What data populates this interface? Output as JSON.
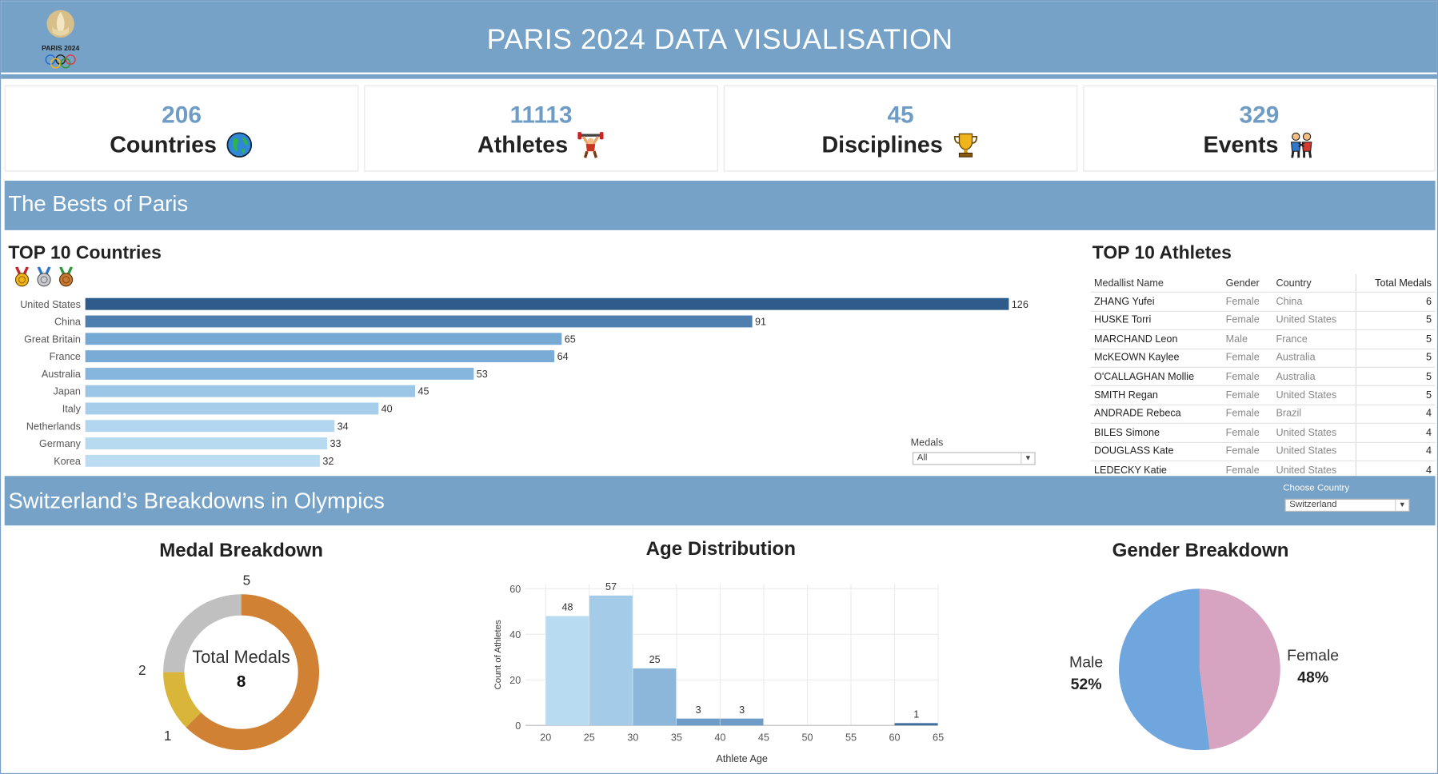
{
  "header": {
    "title": "PARIS 2024 DATA VISUALISATION",
    "logo_text": "PARIS 2024"
  },
  "kpis": [
    {
      "value": "206",
      "label": "Countries",
      "icon": "globe-icon"
    },
    {
      "value": "11113",
      "label": "Athletes",
      "icon": "weightlifter-icon"
    },
    {
      "value": "45",
      "label": "Disciplines",
      "icon": "trophy-icon"
    },
    {
      "value": "329",
      "label": "Events",
      "icon": "wrestlers-icon"
    }
  ],
  "bests_band": "The Bests of Paris",
  "country_band": "Switzerland’s Breakdowns in Olympics",
  "country_filter": {
    "label": "Choose Country",
    "value": "Switzerland"
  },
  "medal_filter": {
    "label": "Medals",
    "value": "All"
  },
  "top_athletes": {
    "title": "TOP 10 Athletes",
    "columns": [
      "Medallist Name",
      "Gender",
      "Country",
      "Total Medals"
    ],
    "rows": [
      [
        "ZHANG Yufei",
        "Female",
        "China",
        "6"
      ],
      [
        "HUSKE Torri",
        "Female",
        "United States",
        "5"
      ],
      [
        "MARCHAND Leon",
        "Male",
        "France",
        "5"
      ],
      [
        "McKEOWN Kaylee",
        "Female",
        "Australia",
        "5"
      ],
      [
        "O'CALLAGHAN Mollie",
        "Female",
        "Australia",
        "5"
      ],
      [
        "SMITH Regan",
        "Female",
        "United States",
        "5"
      ],
      [
        "ANDRADE Rebeca",
        "Female",
        "Brazil",
        "4"
      ],
      [
        "BILES Simone",
        "Female",
        "United States",
        "4"
      ],
      [
        "DOUGLASS Kate",
        "Female",
        "United States",
        "4"
      ],
      [
        "LEDECKY Katie",
        "Female",
        "United States",
        "4"
      ]
    ]
  },
  "chart_data": [
    {
      "type": "bar",
      "title": "TOP 10 Countries",
      "orientation": "horizontal",
      "categories": [
        "United States",
        "China",
        "Great Britain",
        "France",
        "Australia",
        "Japan",
        "Italy",
        "Netherlands",
        "Germany",
        "Korea"
      ],
      "values": [
        126,
        91,
        65,
        64,
        53,
        45,
        40,
        34,
        33,
        32
      ],
      "colors": [
        "#2e5b8a",
        "#4f7fae",
        "#76a8d4",
        "#7aabd6",
        "#86b5dd",
        "#9cc6e6",
        "#a6cdea",
        "#b2d6ef",
        "#b8daf1",
        "#bcdcf2"
      ],
      "xlim": [
        0,
        126
      ],
      "legend_icons": [
        "gold-medal-icon",
        "silver-medal-icon",
        "bronze-medal-icon"
      ]
    },
    {
      "type": "pie",
      "title": "Medal Breakdown",
      "center_label": "Total Medals",
      "center_value": "8",
      "slices": [
        {
          "label": "Bronze",
          "value": 5,
          "color": "#d08133"
        },
        {
          "label": "Gold",
          "value": 1,
          "color": "#d9b53a"
        },
        {
          "label": "Silver",
          "value": 2,
          "color": "#c0c0c0"
        }
      ]
    },
    {
      "type": "bar",
      "title": "Age Distribution",
      "xlabel": "Athlete Age",
      "ylabel": "Count of Athletes",
      "bins": [
        [
          20,
          25
        ],
        [
          25,
          30
        ],
        [
          30,
          35
        ],
        [
          35,
          40
        ],
        [
          40,
          45
        ],
        [
          60,
          65
        ]
      ],
      "values": [
        48,
        57,
        25,
        3,
        3,
        1
      ],
      "colors": [
        "#b9dbf1",
        "#a4cbe8",
        "#8cb6da",
        "#6d9cc8",
        "#6d9cc8",
        "#3f6e9f"
      ],
      "xticks": [
        "20",
        "25",
        "30",
        "35",
        "40",
        "45",
        "50",
        "55",
        "60",
        "65"
      ],
      "yticks": [
        "0",
        "20",
        "40",
        "60"
      ],
      "xlim": [
        20,
        65
      ],
      "ylim": [
        0,
        62
      ],
      "grid": true
    },
    {
      "type": "pie",
      "title": "Gender Breakdown",
      "slices": [
        {
          "label": "Female",
          "pct_label": "48%",
          "value": 48,
          "color": "#d6a4c0"
        },
        {
          "label": "Male",
          "pct_label": "52%",
          "value": 52,
          "color": "#6fa6dd"
        }
      ]
    }
  ]
}
